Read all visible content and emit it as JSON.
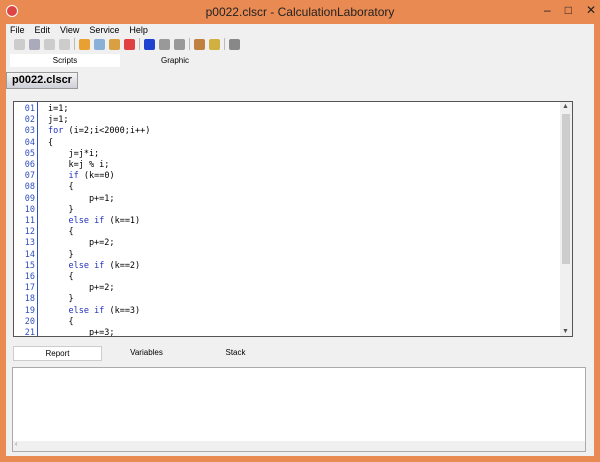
{
  "window": {
    "title": "p0022.clscr - CalculationLaboratory",
    "controls": [
      "–",
      "□",
      "✕"
    ],
    "accent": "#e98a52"
  },
  "menu": [
    "File",
    "Edit",
    "View",
    "Service",
    "Help"
  ],
  "toolbar": [
    {
      "icon": "new-icon",
      "color": "#ccc"
    },
    {
      "icon": "save-icon",
      "color": "#aab"
    },
    {
      "icon": "undo-icon",
      "color": "#ccc"
    },
    {
      "icon": "redo-icon",
      "color": "#ccc"
    },
    {
      "icon": "cut-icon",
      "color": "#e8a030"
    },
    {
      "icon": "copy-icon",
      "color": "#8ab0d8"
    },
    {
      "icon": "paste-icon",
      "color": "#d8a040"
    },
    {
      "icon": "delete-icon",
      "color": "#e04040"
    },
    {
      "icon": "run-icon",
      "color": "#2040d0"
    },
    {
      "icon": "pause-icon",
      "color": "#999"
    },
    {
      "icon": "stop-icon",
      "color": "#999"
    },
    {
      "icon": "find-icon",
      "color": "#c08040"
    },
    {
      "icon": "replace-icon",
      "color": "#d0b040"
    },
    {
      "icon": "settings-icon",
      "color": "#888"
    }
  ],
  "view_tabs": [
    "Scripts",
    "Graphic"
  ],
  "file_tab": "p0022.clscr",
  "code_lines": [
    {
      "n": "01",
      "code": "i=1;"
    },
    {
      "n": "02",
      "code": "j=1;"
    },
    {
      "n": "03",
      "code": "for (i=2;i<2000;i++)"
    },
    {
      "n": "04",
      "code": "{"
    },
    {
      "n": "05",
      "code": "    j=j*i;"
    },
    {
      "n": "06",
      "code": "    k=j % i;"
    },
    {
      "n": "07",
      "code": "    if (k==0)"
    },
    {
      "n": "08",
      "code": "    {"
    },
    {
      "n": "09",
      "code": "        p+=1;"
    },
    {
      "n": "10",
      "code": "    }"
    },
    {
      "n": "11",
      "code": "    else if (k==1)"
    },
    {
      "n": "12",
      "code": "    {"
    },
    {
      "n": "13",
      "code": "        p+=2;"
    },
    {
      "n": "14",
      "code": "    }"
    },
    {
      "n": "15",
      "code": "    else if (k==2)"
    },
    {
      "n": "16",
      "code": "    {"
    },
    {
      "n": "17",
      "code": "        p+=2;"
    },
    {
      "n": "18",
      "code": "    }"
    },
    {
      "n": "19",
      "code": "    else if (k==3)"
    },
    {
      "n": "20",
      "code": "    {"
    },
    {
      "n": "21",
      "code": "        p+=3;"
    }
  ],
  "output_tabs": [
    "Report",
    "Variables",
    "Stack"
  ]
}
